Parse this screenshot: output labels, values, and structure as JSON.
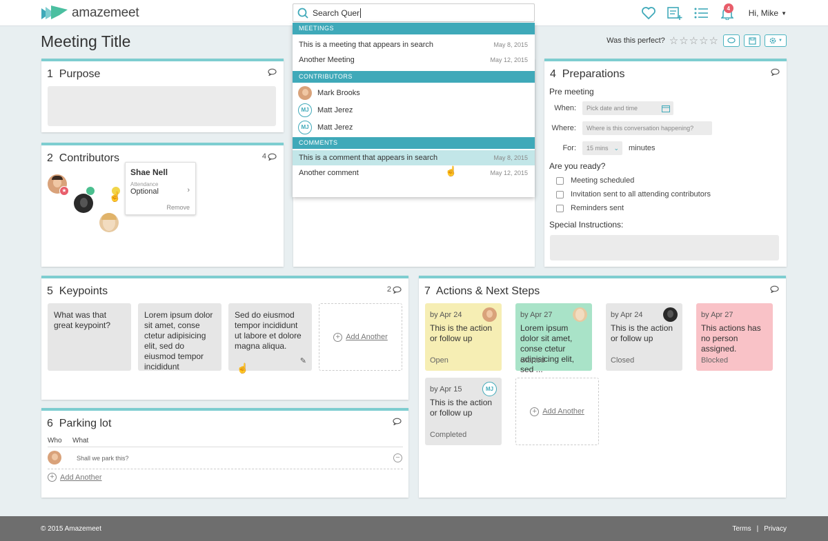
{
  "app": {
    "name": "amazemeet",
    "user_greeting": "Hi, Mike",
    "notification_count": "4"
  },
  "search": {
    "value": "Search Quer"
  },
  "page": {
    "title": "Meeting Title",
    "rating_prompt": "Was this perfect?"
  },
  "dropdown": {
    "meetings_header": "MEETINGS",
    "meetings": [
      {
        "title": "This is a meeting that appears in search",
        "date": "May 8, 2015"
      },
      {
        "title": "Another Meeting",
        "date": "May 12, 2015"
      }
    ],
    "contributors_header": "CONTRIBUTORS",
    "contributors": [
      {
        "name": "Mark Brooks",
        "initials": ""
      },
      {
        "name": "Matt Jerez",
        "initials": "MJ"
      },
      {
        "name": "Matt Jerez",
        "initials": "MJ"
      }
    ],
    "comments_header": "COMMENTS",
    "comments": [
      {
        "title": "This is a comment that appears in search",
        "date": "May 8, 2015"
      },
      {
        "title": "Another comment",
        "date": "May 12, 2015"
      }
    ]
  },
  "purpose": {
    "num": "1",
    "title": "Purpose"
  },
  "contributors_card": {
    "num": "2",
    "title": "Contributors",
    "comment_count": "4",
    "popover": {
      "name": "Shae Nell",
      "attendance_label": "Attendance",
      "attendance_value": "Optional",
      "remove": "Remove"
    }
  },
  "preparations": {
    "num": "4",
    "title": "Preparations",
    "pre_meeting": "Pre meeting",
    "when_label": "When:",
    "when_placeholder": "Pick date and time",
    "where_label": "Where:",
    "where_placeholder": "Where is this conversation happening?",
    "for_label": "For:",
    "for_value": "15 mins",
    "for_unit": "minutes",
    "ready": "Are you ready?",
    "checks": [
      "Meeting scheduled",
      "Invitation sent to all attending contributors",
      "Reminders sent"
    ],
    "special": "Special Instructions:"
  },
  "keypoints": {
    "num": "5",
    "title": "Keypoints",
    "comment_count": "2",
    "items": [
      "What was that great keypoint?",
      "Lorem ipsum dolor sit amet, conse ctetur adipisicing elit, sed do eiusmod tempor incididunt",
      "Sed do eiusmod tempor incididunt ut labore et dolore magna aliqua."
    ],
    "add": "Add Another"
  },
  "actions": {
    "num": "7",
    "title": "Actions & Next Steps",
    "items": [
      {
        "by": "by Apr 24",
        "text": "This is the action or follow up",
        "status": "Open",
        "color": "#f6eeb4"
      },
      {
        "by": "by Apr 27",
        "text": "Lorem ipsum dolor sit amet, conse ctetur adipisicing elit, sed ...",
        "status": "Started",
        "color": "#a9e3c8"
      },
      {
        "by": "by Apr 24",
        "text": "This is the action or follow up",
        "status": "Closed",
        "color": "#e6e6e6"
      },
      {
        "by": "by Apr 27",
        "text": "This actions has no person assigned.",
        "status": "Blocked",
        "color": "#f9c2c7"
      },
      {
        "by": "by Apr 15",
        "text": "This is the action or follow up",
        "status": "Completed",
        "color": "#e6e6e6",
        "initials": "MJ"
      }
    ],
    "add": "Add Another"
  },
  "parking": {
    "num": "6",
    "title": "Parking lot",
    "col_who": "Who",
    "col_what": "What",
    "row_text": "Shall we park this?",
    "add": "Add Another"
  },
  "footer": {
    "copyright": "© 2015 Amazemeet",
    "terms": "Terms",
    "sep": "|",
    "privacy": "Privacy"
  },
  "colors": {
    "accent": "#3fa9b9",
    "card_top": "#7dcdd0",
    "badge": "#e85d6a"
  }
}
